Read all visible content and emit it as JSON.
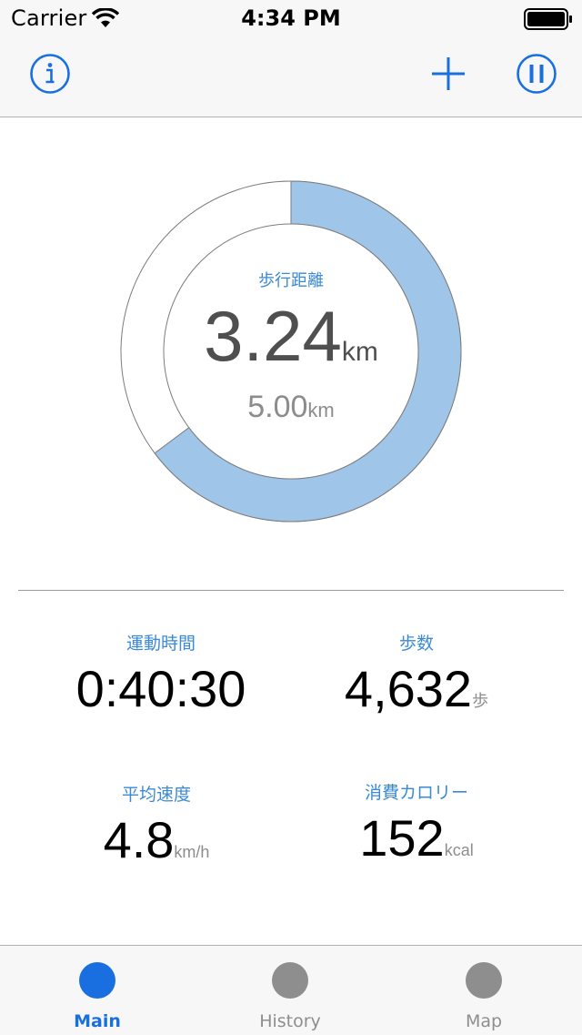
{
  "status_bar": {
    "carrier": "Carrier",
    "time": "4:34 PM"
  },
  "nav": {
    "info_icon": "info-circle-icon",
    "add_icon": "plus-icon",
    "pause_icon": "pause-circle-icon"
  },
  "ring": {
    "label": "歩行距離",
    "distance_value": "3.24",
    "distance_unit": "km",
    "goal_value": "5.00",
    "goal_unit": "km",
    "progress_fraction": 0.648,
    "fill_color": "#9fc5e8"
  },
  "stats": {
    "time": {
      "label": "運動時間",
      "value": "0:40:30",
      "unit": ""
    },
    "steps": {
      "label": "歩数",
      "value": "4,632",
      "unit": "歩"
    },
    "speed": {
      "label": "平均速度",
      "value": "4.8",
      "unit": "km/h"
    },
    "calories": {
      "label": "消費カロリー",
      "value": "152",
      "unit": "kcal"
    }
  },
  "tabs": [
    {
      "label": "Main",
      "active": true
    },
    {
      "label": "History",
      "active": false
    },
    {
      "label": "Map",
      "active": false
    }
  ],
  "colors": {
    "accent": "#1a6fe0",
    "label_blue": "#3a8ad6",
    "inactive": "#8e8e8e"
  }
}
